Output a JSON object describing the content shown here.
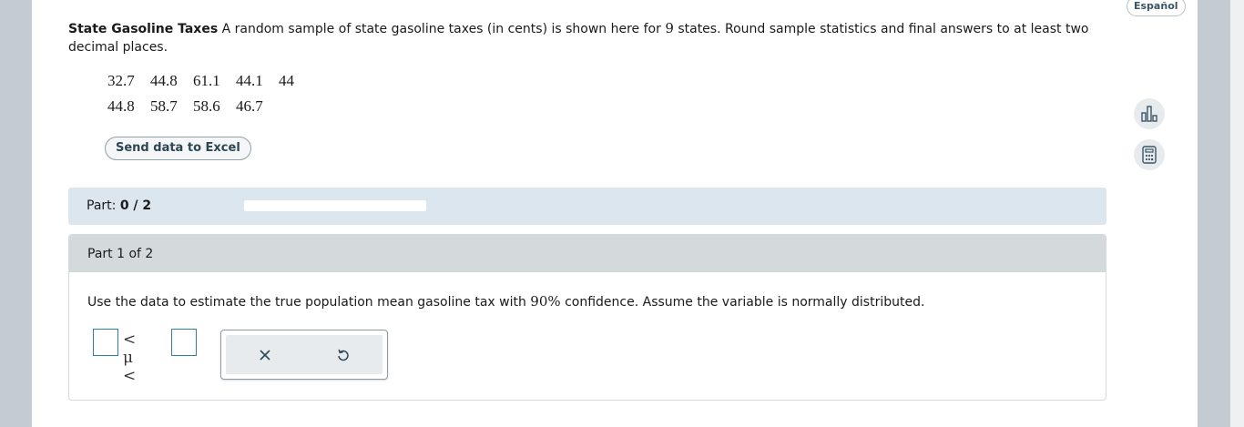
{
  "language_button": "Español",
  "problem": {
    "title": "State Gasoline Taxes",
    "text_before_n": " A random sample of state gasoline taxes (in cents) is shown here for ",
    "n": "9",
    "text_after_n": " states. Round sample statistics and final answers to at least two decimal places."
  },
  "data_rows": [
    [
      "32.7",
      "44.8",
      "61.1",
      "44.1",
      "44"
    ],
    [
      "44.8",
      "58.7",
      "58.6",
      "46.7"
    ]
  ],
  "excel_button": "Send data to Excel",
  "side_icons": [
    "bar-chart-icon",
    "calculator-icon"
  ],
  "part_bar": {
    "label": "Part: ",
    "value": "0 / 2",
    "progress_fraction": 0.0
  },
  "part_header": "Part 1 of 2",
  "question": {
    "before_pct": "Use the data to estimate the true population mean gasoline tax with ",
    "pct": "90%",
    "after_pct": " confidence. Assume the variable is normally distributed."
  },
  "answer": {
    "inequality": "< μ <",
    "lower_value": "",
    "upper_value": ""
  },
  "colors": {
    "accent": "#2f7ea8",
    "part_bar_bg": "#dbe6ee",
    "part_header_bg": "#d4d9dc",
    "frame_bg": "#c5ccd1"
  }
}
